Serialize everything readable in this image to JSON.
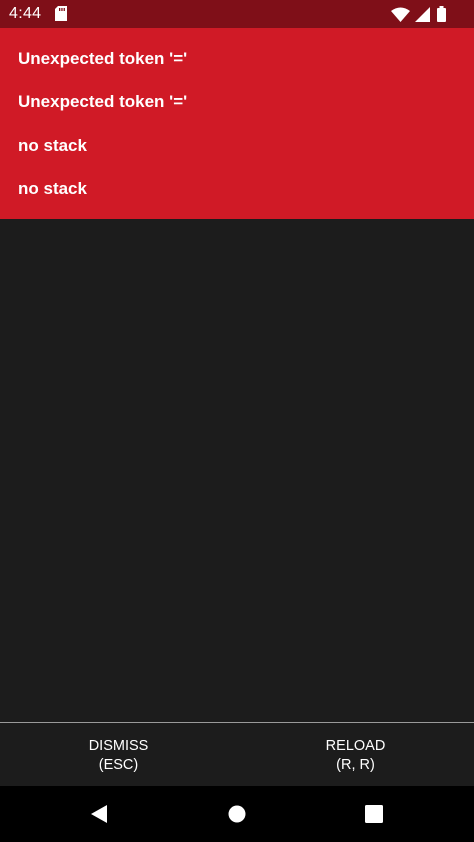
{
  "status_bar": {
    "time": "4:44",
    "icons": [
      "sd-card-icon",
      "wifi-icon",
      "signal-icon",
      "battery-icon"
    ]
  },
  "error": {
    "lines": [
      "Unexpected token '='",
      "Unexpected token '='",
      "no stack",
      "no stack"
    ]
  },
  "buttons": {
    "dismiss": {
      "label": "DISMISS",
      "shortcut": "(ESC)"
    },
    "reload": {
      "label": "RELOAD",
      "shortcut": "(R, R)"
    }
  },
  "nav": {
    "icons": [
      "back-icon",
      "home-icon",
      "recents-icon"
    ]
  },
  "colors": {
    "status_bar": "#7f0f18",
    "error_banner": "#d01a26",
    "background": "#1c1c1c",
    "nav_bar": "#000000",
    "text": "#ffffff"
  }
}
